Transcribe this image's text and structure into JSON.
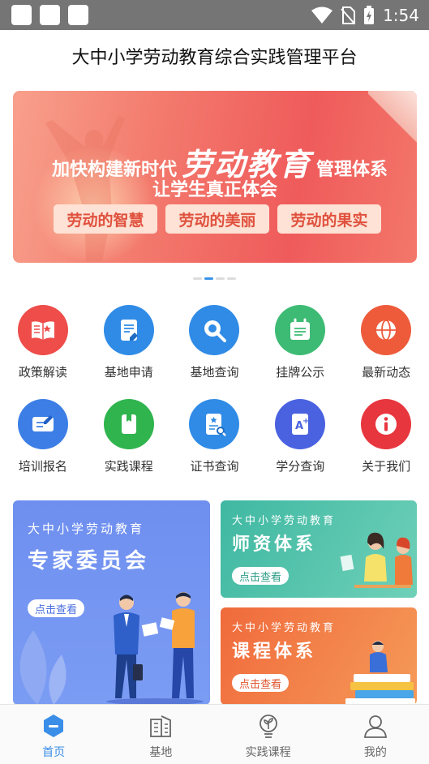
{
  "status_bar": {
    "time": "1:54"
  },
  "header": {
    "title": "大中小学劳动教育综合实践管理平台"
  },
  "banner": {
    "line1_pre": "加快构建新时代",
    "line1_big": "劳动教育",
    "line1_post": "管理体系",
    "line2": "让学生真正体会",
    "tags": [
      "劳动的智慧",
      "劳动的美丽",
      "劳动的果实"
    ],
    "slide_count": 4,
    "active_slide": 2
  },
  "grid": {
    "rows": [
      [
        {
          "label": "政策解读",
          "icon": "book-icon",
          "color": "#ee4d4a"
        },
        {
          "label": "基地申请",
          "icon": "document-edit-icon",
          "color": "#2f8be6"
        },
        {
          "label": "基地查询",
          "icon": "search-icon",
          "color": "#2f8be6"
        },
        {
          "label": "挂牌公示",
          "icon": "notice-board-icon",
          "color": "#3dbb74"
        },
        {
          "label": "最新动态",
          "icon": "globe-icon",
          "color": "#ee5b3b"
        }
      ],
      [
        {
          "label": "培训报名",
          "icon": "signup-icon",
          "color": "#3c7ee6"
        },
        {
          "label": "实践课程",
          "icon": "course-book-icon",
          "color": "#2fb44e"
        },
        {
          "label": "证书查询",
          "icon": "certificate-icon",
          "color": "#2f8be6"
        },
        {
          "label": "学分查询",
          "icon": "grade-icon",
          "color": "#4a62e0"
        },
        {
          "label": "关于我们",
          "icon": "info-icon",
          "color": "#e8363f"
        }
      ]
    ]
  },
  "cards": {
    "expert": {
      "sub": "大中小学劳动教育",
      "main": "专家委员会",
      "button": "点击查看",
      "accent": "#4a6ee0"
    },
    "teacher": {
      "sub": "大中小学劳动教育",
      "main": "师资体系",
      "button": "点击查看",
      "accent": "#2f9d88"
    },
    "course": {
      "sub": "大中小学劳动教育",
      "main": "课程体系",
      "button": "点击查看",
      "accent": "#e0562f"
    }
  },
  "bottom_nav": [
    {
      "label": "首页",
      "icon": "home-icon",
      "active": true
    },
    {
      "label": "基地",
      "icon": "building-icon",
      "active": false
    },
    {
      "label": "实践课程",
      "icon": "sprout-icon",
      "active": false
    },
    {
      "label": "我的",
      "icon": "profile-icon",
      "active": false
    }
  ]
}
